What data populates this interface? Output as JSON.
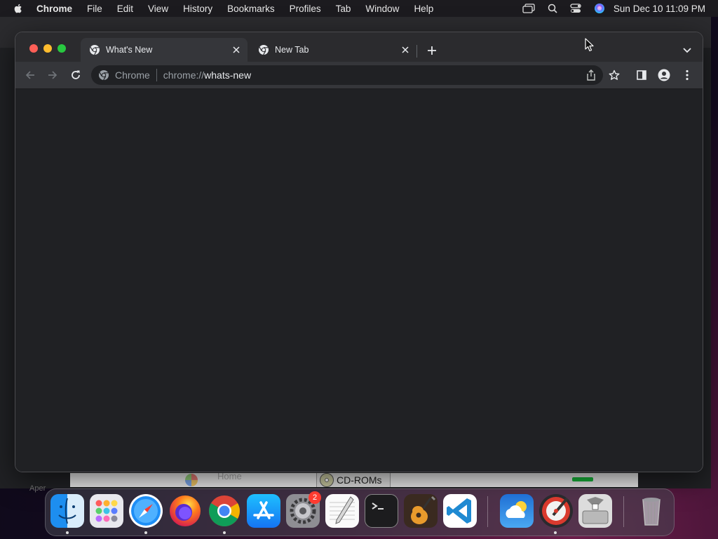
{
  "menubar": {
    "app_name": "Chrome",
    "items": [
      "File",
      "Edit",
      "View",
      "History",
      "Bookmarks",
      "Profiles",
      "Tab",
      "Window",
      "Help"
    ],
    "clock": "Sun Dec 10  11:09 PM"
  },
  "browser": {
    "tabs": [
      {
        "title": "What's New",
        "active": true
      },
      {
        "title": "New Tab",
        "active": false
      }
    ],
    "omnibox": {
      "chip": "Chrome",
      "url_scheme": "chrome://",
      "url_host": "whats-new"
    }
  },
  "background": {
    "finder_home": "Home",
    "finder_cdroms": "CD-ROMs",
    "aperture": "Aper"
  },
  "dock": {
    "apps": [
      "Finder",
      "Launchpad",
      "Safari",
      "Firefox",
      "Google Chrome",
      "App Store",
      "System Settings",
      "TextEdit",
      "Terminal",
      "GarageBand",
      "Visual Studio Code",
      "Weather",
      "Instruments",
      "Boot Camp Assistant",
      "Trash"
    ],
    "settings_badge": "2"
  },
  "colors": {
    "menubar_bg": "#1c1b1f",
    "tabstrip_bg": "#2b2b2e",
    "toolbar_bg": "#35363a",
    "content_bg": "#202124",
    "close": "#fe5f57",
    "minimize": "#febc2e",
    "maximize": "#28c840"
  }
}
